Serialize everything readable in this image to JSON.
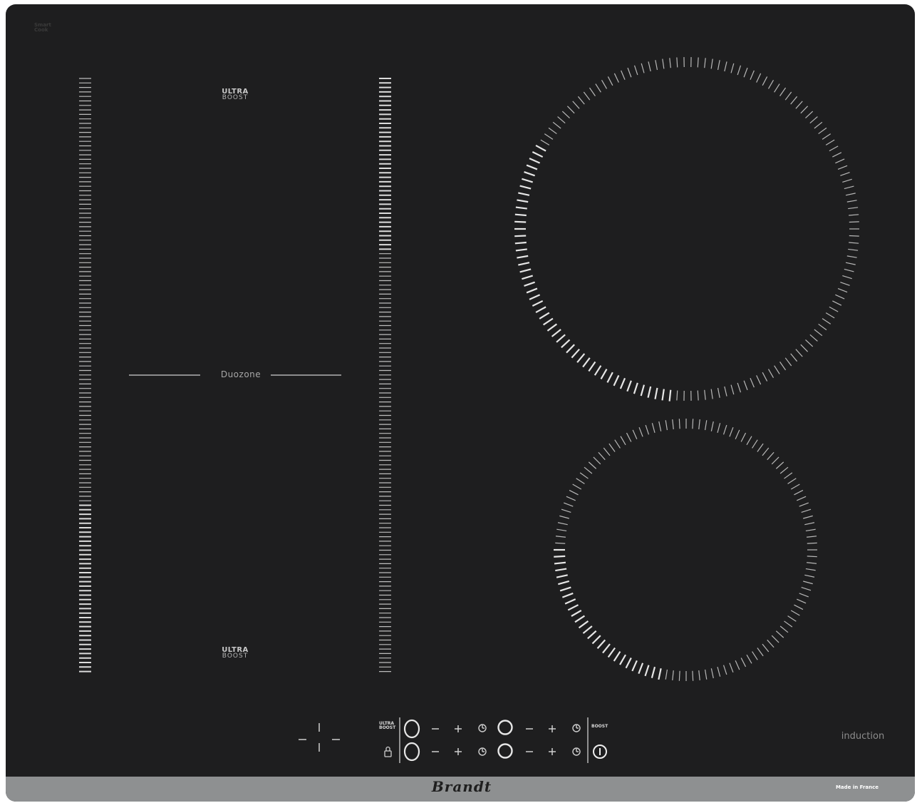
{
  "cooktop": {
    "badge_line1": "Smart",
    "badge_line2": "Cook",
    "duozone_label": "Duozone",
    "boost_top_line1": "ULTRA",
    "boost_top_line2": "BOOST",
    "boost_bottom_line1": "ULTRA",
    "boost_bottom_line2": "BOOST",
    "induction_label": "induction"
  },
  "control_panel": {
    "ultra_boost_line1": "ULTRA",
    "ultra_boost_line2": "BOOST",
    "boost_label": "BOOST",
    "row1": [
      {
        "name": "zone-selector",
        "glyph": "◯"
      },
      {
        "name": "minus",
        "glyph": "−"
      },
      {
        "name": "plus",
        "glyph": "+"
      },
      {
        "name": "timer",
        "glyph": "◷"
      },
      {
        "name": "zone-selector",
        "glyph": "◯"
      },
      {
        "name": "minus",
        "glyph": "−"
      },
      {
        "name": "plus",
        "glyph": "+"
      },
      {
        "name": "timer",
        "glyph": "◷"
      }
    ],
    "row2": [
      {
        "name": "lock",
        "glyph": "🔒"
      },
      {
        "name": "zone-selector",
        "glyph": "◯"
      },
      {
        "name": "minus",
        "glyph": "−"
      },
      {
        "name": "plus",
        "glyph": "+"
      },
      {
        "name": "timer",
        "glyph": "◷"
      },
      {
        "name": "zone-selector",
        "glyph": "◯"
      },
      {
        "name": "minus",
        "glyph": "−"
      },
      {
        "name": "plus",
        "glyph": "+"
      },
      {
        "name": "timer",
        "glyph": "◷"
      },
      {
        "name": "power",
        "glyph": "⏻"
      }
    ]
  },
  "footer": {
    "brand": "Brandt",
    "origin": "Made in France"
  },
  "colors": {
    "glass": "#1e1e1f",
    "marks": "#d9d9d9",
    "footer": "#8e9091"
  }
}
